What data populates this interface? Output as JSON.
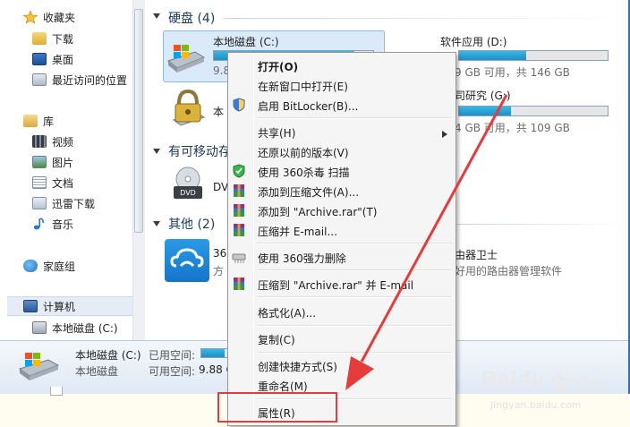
{
  "nav": {
    "favorites": "收藏夹",
    "downloads": "下载",
    "desktop": "桌面",
    "recent": "最近访问的位置",
    "libraries": "库",
    "videos": "视频",
    "pictures": "图片",
    "documents": "文档",
    "xunlei": "迅雷下载",
    "music": "音乐",
    "homegroup": "家庭组",
    "computer": "计算机",
    "local_disk_c": "本地磁盘 (C:)"
  },
  "content": {
    "group_hdd": "硬盘 (4)",
    "group_removable": "有可移动存",
    "group_other": "其他 (2)",
    "drive_c_name": "本地磁盘 (C:)",
    "drive_c_free": "9.8",
    "drive_c_fill": 0.88,
    "drive_d_name": "软件应用 (D:)",
    "drive_d_free": "9 GB 可用，共 146 GB",
    "drive_d_fill": 0.45,
    "drive_locked_name": "本",
    "drive_g_name": "司研究 (G:)",
    "drive_g_free": "4 GB 可用，共 109 GB",
    "drive_g_fill": 0.35,
    "dvd_name": "DV",
    "cloud_name": "360",
    "cloud_desc": "方",
    "router_name": "由器卫士",
    "router_desc": "好用的路由器管理软件"
  },
  "details": {
    "drive_name": "本地磁盘 (C:)",
    "drive_type": "本地磁盘",
    "used_label": "已用空间:",
    "free_label": "可用空间:",
    "free_value": "9.88 G",
    "used_fill": 0.88
  },
  "menu": {
    "open": "打开(O)",
    "open_new_window": "在新窗口中打开(E)",
    "bitlocker": "启用 BitLocker(B)...",
    "share": "共享(H)",
    "restore": "还原以前的版本(V)",
    "scan360": "使用 360杀毒 扫描",
    "add_archive": "添加到压缩文件(A)...",
    "add_archive_rar": "添加到 \"Archive.rar\"(T)",
    "compress_email": "压缩并 E-mail...",
    "delete360": "使用 360强力删除",
    "compress_rar_email": "压缩到 \"Archive.rar\" 并 E-mail",
    "format": "格式化(A)...",
    "copy": "复制(C)",
    "create_shortcut": "创建快捷方式(S)",
    "rename": "重命名(M)",
    "properties": "属性(R)"
  },
  "watermark": {
    "brand": "Baidu",
    "sub": "经验",
    "url": "jingyan.baidu.com"
  },
  "colors": {
    "accent_red": "#e63b3b",
    "bar_blue": "#26a3d6",
    "window_border": "#3c6fa8"
  }
}
